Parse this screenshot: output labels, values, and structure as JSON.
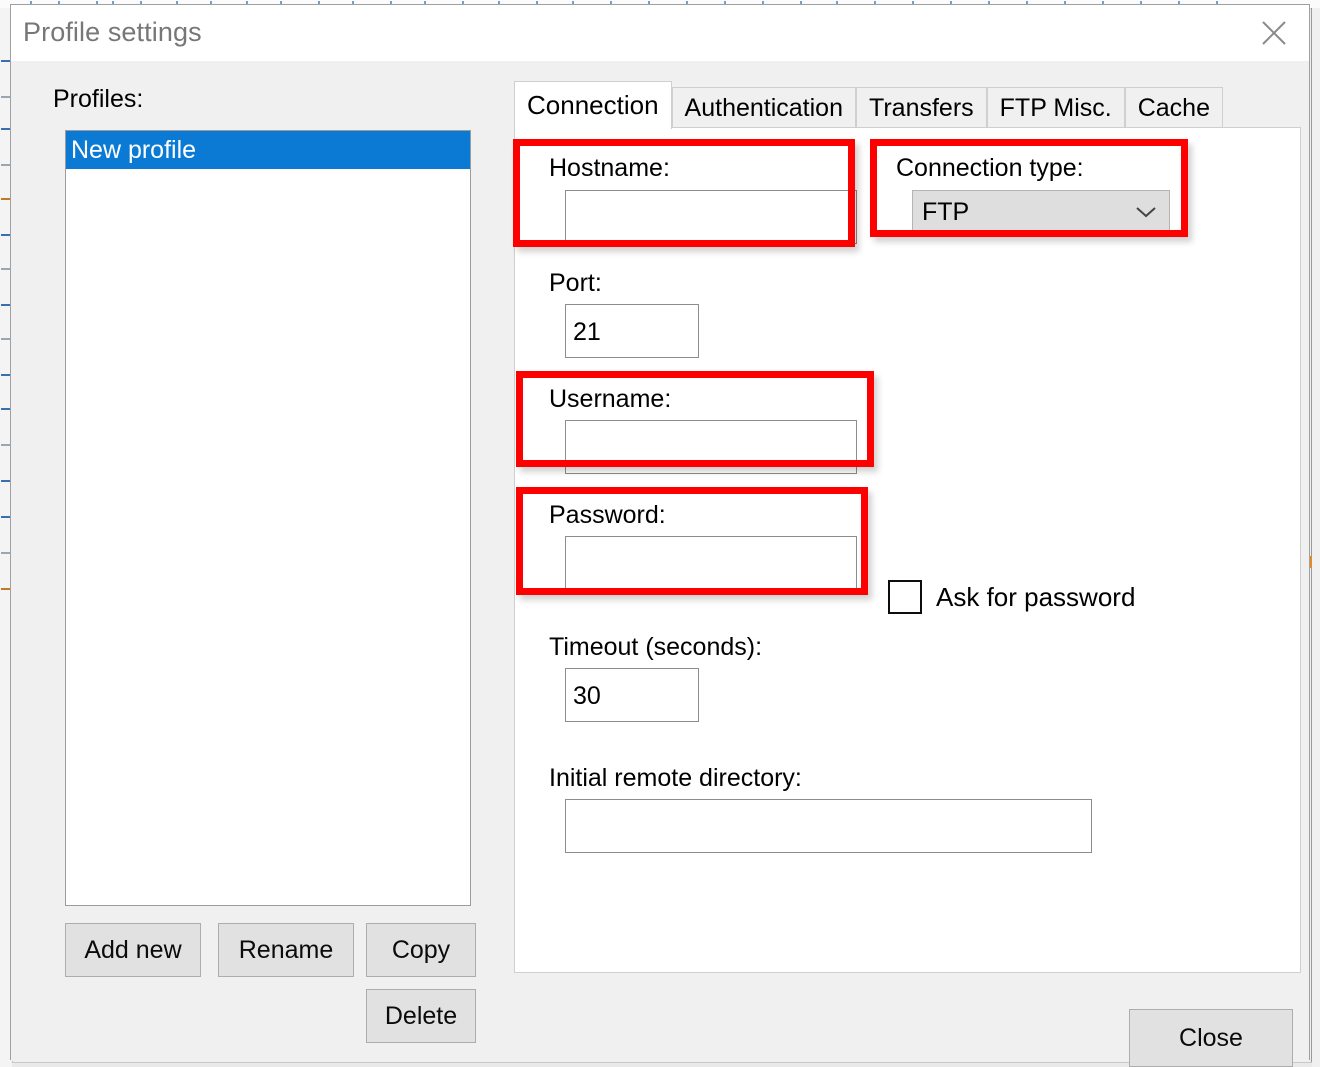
{
  "window": {
    "title": "Profile settings",
    "close_icon": "close-x-icon"
  },
  "left_pane": {
    "profiles_label": "Profiles:",
    "profiles": [
      {
        "name": "New profile",
        "selected": true
      }
    ],
    "buttons": {
      "add_new": "Add new",
      "rename": "Rename",
      "copy": "Copy",
      "delete": "Delete"
    }
  },
  "tabs": [
    {
      "label": "Connection",
      "active": true
    },
    {
      "label": "Authentication",
      "active": false
    },
    {
      "label": "Transfers",
      "active": false
    },
    {
      "label": "FTP Misc.",
      "active": false
    },
    {
      "label": "Cache",
      "active": false
    }
  ],
  "connection_tab": {
    "hostname": {
      "label": "Hostname:",
      "value": "",
      "placeholder": ""
    },
    "connection_type": {
      "label": "Connection type:",
      "value": "FTP",
      "arrow_icon": "chevron-down-icon"
    },
    "port": {
      "label": "Port:",
      "value": "21"
    },
    "username": {
      "label": "Username:",
      "value": "",
      "placeholder": ""
    },
    "password": {
      "label": "Password:",
      "value": "",
      "placeholder": ""
    },
    "ask_for_password": {
      "label": "Ask for password",
      "checked": false
    },
    "timeout": {
      "label": "Timeout (seconds):",
      "value": "30"
    },
    "initial_remote_directory": {
      "label": "Initial remote directory:",
      "value": "",
      "placeholder": ""
    }
  },
  "footer": {
    "close": "Close"
  },
  "annotations": {
    "highlight_color": "#fd0000",
    "highlighted_fields": [
      "Hostname:",
      "Connection type:",
      "Username:",
      "Password:"
    ]
  },
  "colors": {
    "selection_blue": "#0a7ad4",
    "dialog_background": "#f0f0f0",
    "panel_white": "#ffffff",
    "title_text": "#777777",
    "button_face": "#e1e1e1"
  }
}
